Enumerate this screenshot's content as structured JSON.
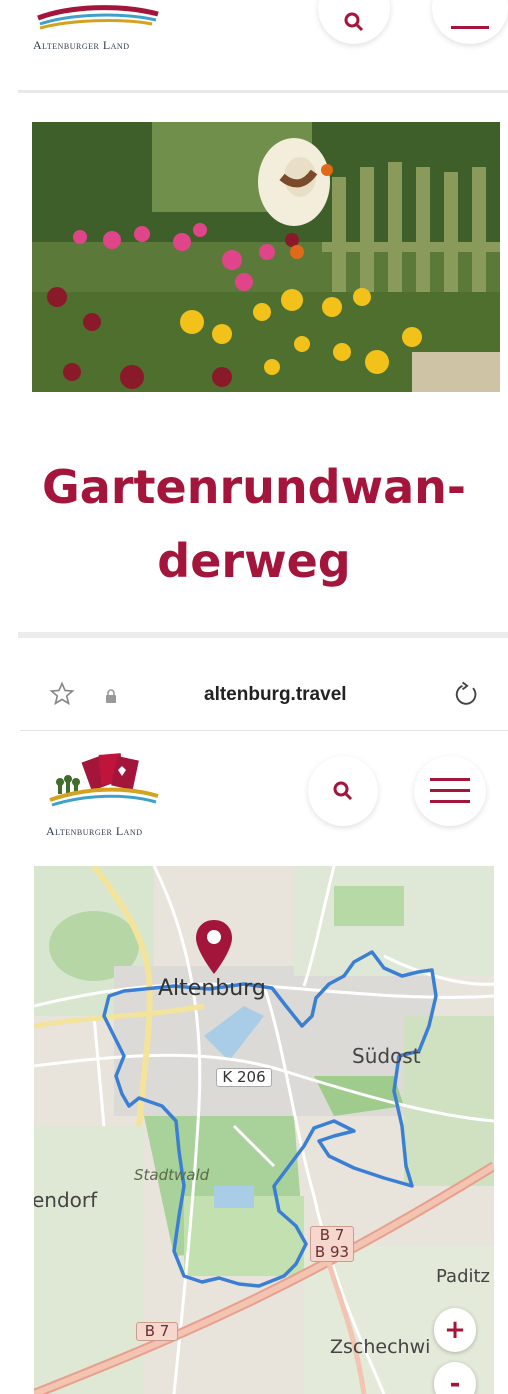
{
  "top_header": {
    "logo_text": "Altenburger Land"
  },
  "article": {
    "title_line1": "Gartenrundwan-",
    "title_line2": "derweg"
  },
  "browser": {
    "url": "altenburg.travel"
  },
  "header": {
    "logo_text": "Altenburger Land"
  },
  "map": {
    "labels": {
      "city": "Altenburg",
      "district_se": "Südost",
      "forest": "Stadtwald",
      "village_w": "endorf",
      "village_e": "Paditz",
      "village_s": "Zschechwi"
    },
    "road_signs": {
      "k206": "K 206",
      "b7_top": "B 7",
      "b93": "B 93",
      "b7_bottom": "B 7"
    },
    "zoom_in_label": "+",
    "zoom_out_label": "-"
  },
  "colors": {
    "brand": "#a3153a",
    "route": "#3b7fd4"
  }
}
